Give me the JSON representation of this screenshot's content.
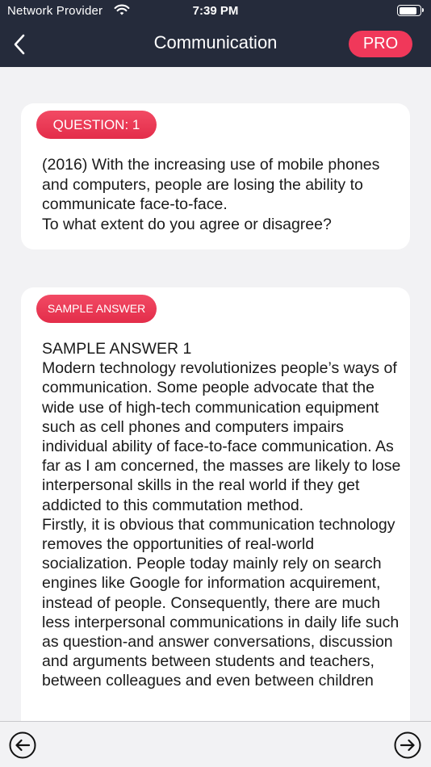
{
  "status_bar": {
    "carrier": "Network Provider",
    "time": "7:39 PM",
    "battery_level": 0.9,
    "icons": [
      "wifi-icon",
      "battery-icon"
    ]
  },
  "nav": {
    "title": "Communication",
    "pro_label": "PRO",
    "back_icon": "chevron-left-icon"
  },
  "question": {
    "badge": "QUESTION: 1",
    "lines": [
      "(2016) With the increasing use of mobile phones and computers, people are losing the ability to communicate face-to-face.",
      "To what extent do you agree or disagree?"
    ]
  },
  "answer": {
    "badge": "SAMPLE ANSWER",
    "heading": "SAMPLE ANSWER 1",
    "paragraphs": [
      "Modern technology revolutionizes people’s ways of communication. Some people advocate that the wide use of high-tech communication equipment such as cell phones and computers impairs individual ability of face-to-face communication. As far as I am concerned, the masses are likely to lose interpersonal skills in the real world if they get addicted to this commutation method.",
      "Firstly, it is obvious that communication technology removes the opportunities of real-world socialization. People today mainly rely on search engines like Google for information acquirement, instead of people. Consequently, there are much less interpersonal communications in daily life such as question-and answer conversations, discussion and arguments between students and teachers, between colleagues and even between children"
    ]
  },
  "footer": {
    "prev_icon": "arrow-left-circle-icon",
    "next_icon": "arrow-right-circle-icon"
  },
  "colors": {
    "header_bg": "#252b3b",
    "accent": "#f0385a",
    "page_bg": "#f2f2f4"
  }
}
